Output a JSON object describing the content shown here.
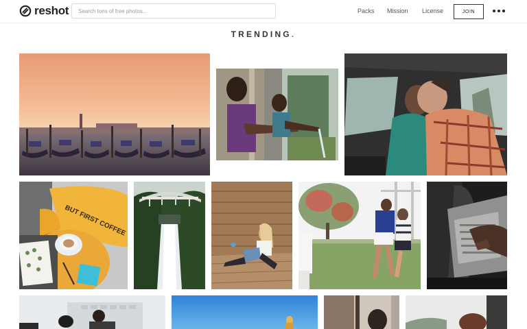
{
  "header": {
    "logo_text": "reshot",
    "search": {
      "placeholder": "Search tons of free photos..."
    },
    "nav": {
      "packs": "Packs",
      "mission": "Mission",
      "license": "License"
    },
    "join_label": "JOIN",
    "more_icon": "more-horizontal-icon"
  },
  "section": {
    "title": "TRENDING",
    "title_dot": "."
  },
  "photos": [
    {
      "subject": "venice-gondolas-sunset"
    },
    {
      "subject": "children-at-window-with-water"
    },
    {
      "subject": "couple-in-car"
    },
    {
      "subject": "but-first-coffee-pillow",
      "text": "BUT FIRST COFFEE"
    },
    {
      "subject": "waterfall-bridge"
    },
    {
      "subject": "girl-sitting-wooden-wall"
    },
    {
      "subject": "rugby-players"
    },
    {
      "subject": "hands-typing-laptop"
    },
    {
      "subject": "office-people"
    },
    {
      "subject": "blue-sky-person"
    },
    {
      "subject": "person-at-window"
    },
    {
      "subject": "outdoor-scene"
    }
  ],
  "colors": {
    "accent_dot": "#e23b3b"
  }
}
